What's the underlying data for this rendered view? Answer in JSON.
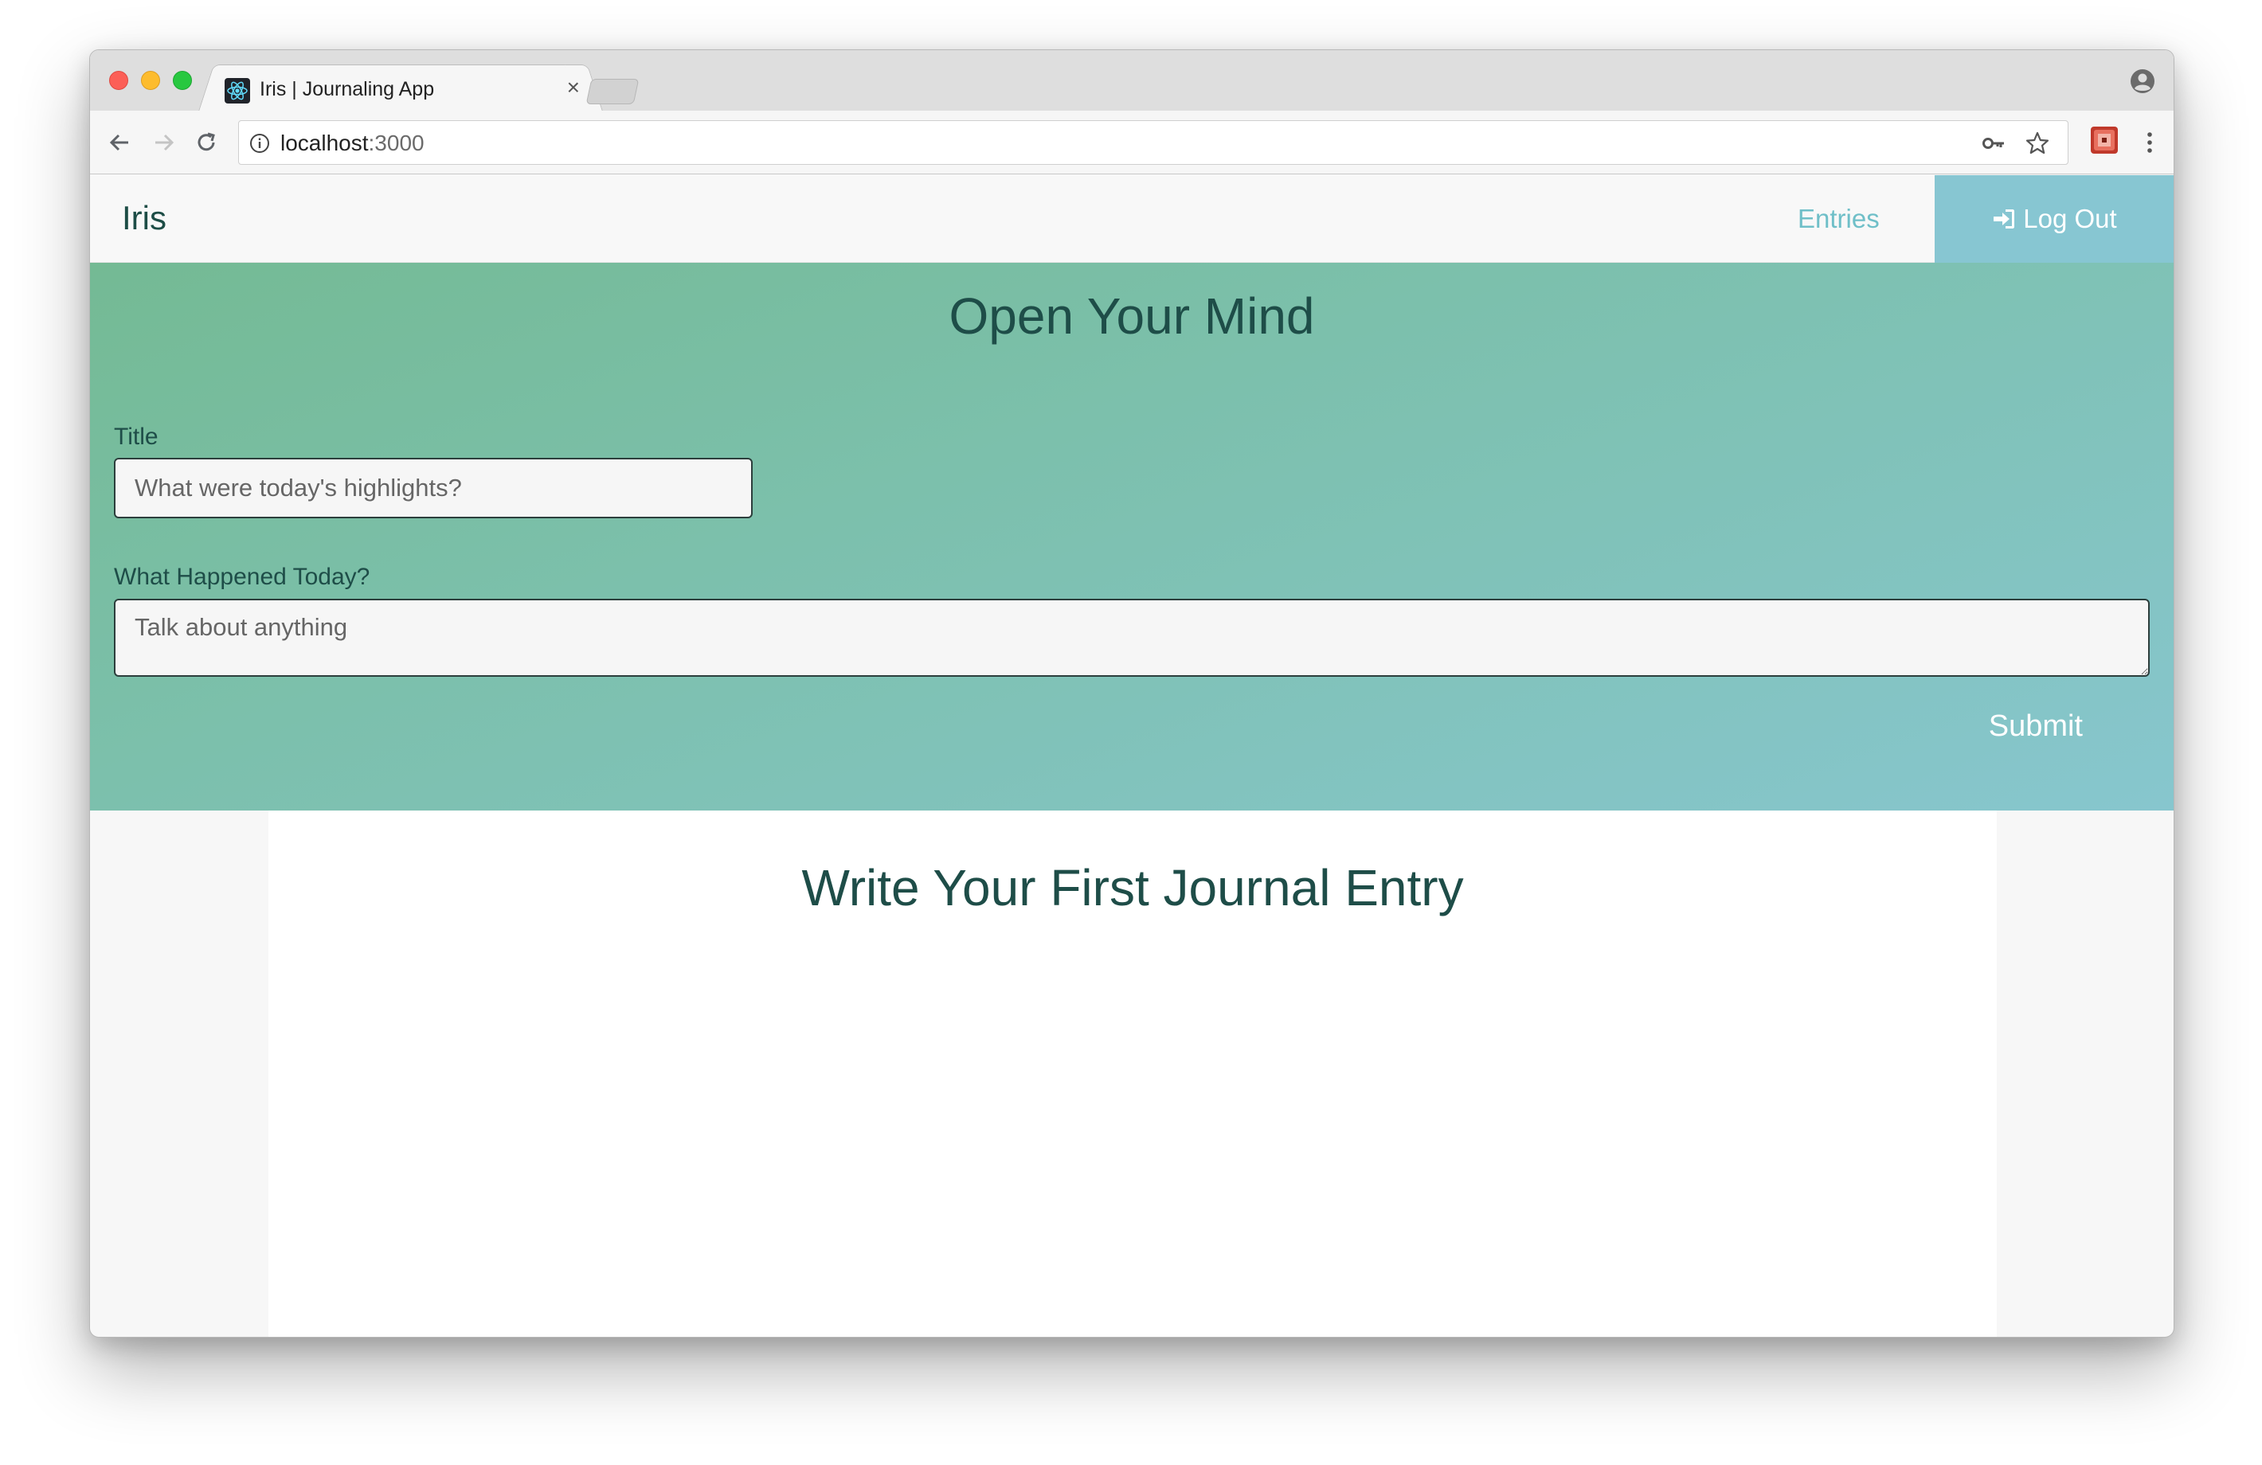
{
  "browser": {
    "tab_title": "Iris | Journaling App",
    "tab_close": "×",
    "url_host": "localhost",
    "url_port": ":3000"
  },
  "navbar": {
    "brand": "Iris",
    "entries_label": "Entries",
    "logout_label": "Log Out"
  },
  "hero": {
    "title": "Open Your Mind",
    "title_field_label": "Title",
    "title_field_placeholder": "What were today's highlights?",
    "body_field_label": "What Happened Today?",
    "body_field_placeholder": "Talk about anything",
    "submit_label": "Submit"
  },
  "entries": {
    "heading": "Write Your First Journal Entry"
  },
  "colors": {
    "accent": "#87c6d2",
    "brand_text": "#1d4d46",
    "link": "#6fbfc8",
    "hero_gradient_start": "#74ba94",
    "hero_gradient_end": "#87c6ce"
  },
  "icons": {
    "favicon": "react-icon",
    "logout": "sign-in-icon",
    "profile": "user-circle-icon",
    "security": "info-icon",
    "password": "key-icon",
    "bookmark": "star-icon",
    "extension": "extension-icon",
    "menu": "vertical-dots-icon"
  }
}
